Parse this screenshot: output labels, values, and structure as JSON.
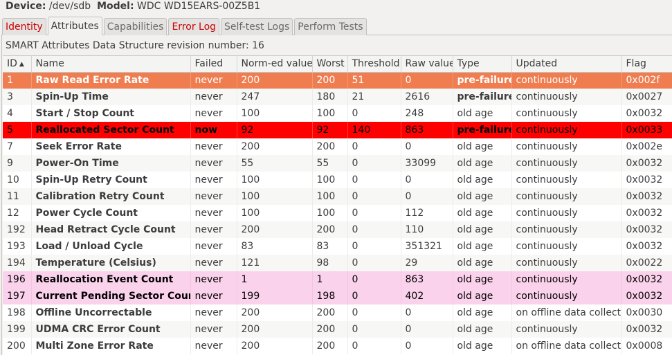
{
  "device": {
    "device_label": "Device:",
    "device_value": "/dev/sdb",
    "model_label": "Model:",
    "model_value": "WDC WD15EARS-00Z5B1"
  },
  "tabs": [
    {
      "label": "Identity",
      "state": "warning"
    },
    {
      "label": "Attributes",
      "state": "active"
    },
    {
      "label": "Capabilities",
      "state": "normal"
    },
    {
      "label": "Error Log",
      "state": "warning"
    },
    {
      "label": "Self-test Logs",
      "state": "normal"
    },
    {
      "label": "Perform Tests",
      "state": "normal"
    }
  ],
  "revision_text": "SMART Attributes Data Structure revision number: 16",
  "table": {
    "columns": [
      "ID",
      "Name",
      "Failed",
      "Norm-ed value",
      "Worst",
      "Threshold",
      "Raw value",
      "Type",
      "Updated",
      "Flag"
    ],
    "sort_indicator": "▲",
    "rows": [
      {
        "id": "1",
        "name": "Raw Read Error Rate",
        "failed": "never",
        "norm": "200",
        "worst": "200",
        "threshold": "51",
        "raw": "0",
        "type": "pre-failure",
        "updated": "continuously",
        "flag": "0x002f",
        "highlight": "orange"
      },
      {
        "id": "3",
        "name": "Spin-Up Time",
        "failed": "never",
        "norm": "247",
        "worst": "180",
        "threshold": "21",
        "raw": "2616",
        "type": "pre-failure",
        "updated": "continuously",
        "flag": "0x0027",
        "highlight": "none"
      },
      {
        "id": "4",
        "name": "Start / Stop Count",
        "failed": "never",
        "norm": "100",
        "worst": "100",
        "threshold": "0",
        "raw": "248",
        "type": "old age",
        "updated": "continuously",
        "flag": "0x0032",
        "highlight": "none"
      },
      {
        "id": "5",
        "name": "Reallocated Sector Count",
        "failed": "now",
        "norm": "92",
        "worst": "92",
        "threshold": "140",
        "raw": "863",
        "type": "pre-failure",
        "updated": "continuously",
        "flag": "0x0033",
        "highlight": "red"
      },
      {
        "id": "7",
        "name": "Seek Error Rate",
        "failed": "never",
        "norm": "200",
        "worst": "200",
        "threshold": "0",
        "raw": "0",
        "type": "old age",
        "updated": "continuously",
        "flag": "0x002e",
        "highlight": "none"
      },
      {
        "id": "9",
        "name": "Power-On Time",
        "failed": "never",
        "norm": "55",
        "worst": "55",
        "threshold": "0",
        "raw": "33099",
        "type": "old age",
        "updated": "continuously",
        "flag": "0x0032",
        "highlight": "none"
      },
      {
        "id": "10",
        "name": "Spin-Up Retry Count",
        "failed": "never",
        "norm": "100",
        "worst": "100",
        "threshold": "0",
        "raw": "0",
        "type": "old age",
        "updated": "continuously",
        "flag": "0x0032",
        "highlight": "none"
      },
      {
        "id": "11",
        "name": "Calibration Retry Count",
        "failed": "never",
        "norm": "100",
        "worst": "100",
        "threshold": "0",
        "raw": "0",
        "type": "old age",
        "updated": "continuously",
        "flag": "0x0032",
        "highlight": "none"
      },
      {
        "id": "12",
        "name": "Power Cycle Count",
        "failed": "never",
        "norm": "100",
        "worst": "100",
        "threshold": "0",
        "raw": "112",
        "type": "old age",
        "updated": "continuously",
        "flag": "0x0032",
        "highlight": "none"
      },
      {
        "id": "192",
        "name": "Head Retract Cycle Count",
        "failed": "never",
        "norm": "200",
        "worst": "200",
        "threshold": "0",
        "raw": "110",
        "type": "old age",
        "updated": "continuously",
        "flag": "0x0032",
        "highlight": "none"
      },
      {
        "id": "193",
        "name": "Load / Unload Cycle",
        "failed": "never",
        "norm": "83",
        "worst": "83",
        "threshold": "0",
        "raw": "351321",
        "type": "old age",
        "updated": "continuously",
        "flag": "0x0032",
        "highlight": "none"
      },
      {
        "id": "194",
        "name": "Temperature (Celsius)",
        "failed": "never",
        "norm": "121",
        "worst": "98",
        "threshold": "0",
        "raw": "29",
        "type": "old age",
        "updated": "continuously",
        "flag": "0x0022",
        "highlight": "none"
      },
      {
        "id": "196",
        "name": "Reallocation Event Count",
        "failed": "never",
        "norm": "1",
        "worst": "1",
        "threshold": "0",
        "raw": "863",
        "type": "old age",
        "updated": "continuously",
        "flag": "0x0032",
        "highlight": "pink"
      },
      {
        "id": "197",
        "name": "Current Pending Sector Count",
        "failed": "never",
        "norm": "199",
        "worst": "198",
        "threshold": "0",
        "raw": "402",
        "type": "old age",
        "updated": "continuously",
        "flag": "0x0032",
        "highlight": "pink"
      },
      {
        "id": "198",
        "name": "Offline Uncorrectable",
        "failed": "never",
        "norm": "200",
        "worst": "200",
        "threshold": "0",
        "raw": "0",
        "type": "old age",
        "updated": "on offline data collect.",
        "flag": "0x0030",
        "highlight": "none"
      },
      {
        "id": "199",
        "name": "UDMA CRC Error Count",
        "failed": "never",
        "norm": "200",
        "worst": "200",
        "threshold": "0",
        "raw": "0",
        "type": "old age",
        "updated": "continuously",
        "flag": "0x0032",
        "highlight": "none"
      },
      {
        "id": "200",
        "name": "Multi Zone Error Rate",
        "failed": "never",
        "norm": "200",
        "worst": "200",
        "threshold": "0",
        "raw": "0",
        "type": "old age",
        "updated": "on offline data collect.",
        "flag": "0x0008",
        "highlight": "none"
      }
    ]
  },
  "colors": {
    "warning_tab_text": "#cc0000",
    "highlight_orange": "#ef7d50",
    "highlight_red": "#ff0000",
    "highlight_pink": "#fbd2ec"
  }
}
